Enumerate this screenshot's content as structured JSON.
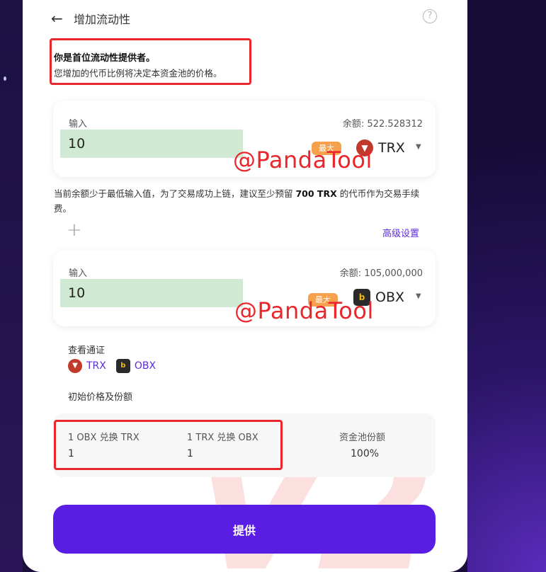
{
  "header": {
    "title": "增加流动性",
    "back_icon": "arrow-left-icon",
    "help_icon": "question-circle-icon"
  },
  "notice": {
    "title": "你是首位流动性提供者。",
    "body": "您增加的代币比例将决定本资金池的价格。"
  },
  "card1": {
    "label": "输入",
    "balance": "余额: 522.528312",
    "value": "10",
    "max_label": "最大",
    "token": "TRX"
  },
  "warning": {
    "pre": "当前余额少于最低输入值，为了交易成功上链，建议至少预留 ",
    "strong": "700 TRX",
    "post": " 的代币作为交易手续费。"
  },
  "advanced": "高级设置",
  "card2": {
    "label": "输入",
    "balance": "余额: 105,000,000",
    "value": "10",
    "max_label": "最大",
    "token": "OBX"
  },
  "watermarks": [
    "@PandaTool",
    "@PandaTool"
  ],
  "view_tokens": {
    "title": "查看通证",
    "tokens": [
      "TRX",
      "OBX"
    ]
  },
  "initial": {
    "title": "初始价格及份额",
    "columns": [
      {
        "header": "1 OBX 兑换 TRX",
        "value": "1"
      },
      {
        "header": "1 TRX 兑换 OBX",
        "value": "1"
      },
      {
        "header": "资金池份额",
        "value": "100%"
      }
    ]
  },
  "submit": "提供",
  "background_mark": "V2",
  "colors": {
    "accent": "#5a1de3",
    "highlight": "#e8262b",
    "input_bg": "#cfe9d2",
    "max_badge": "#f5a14d"
  }
}
